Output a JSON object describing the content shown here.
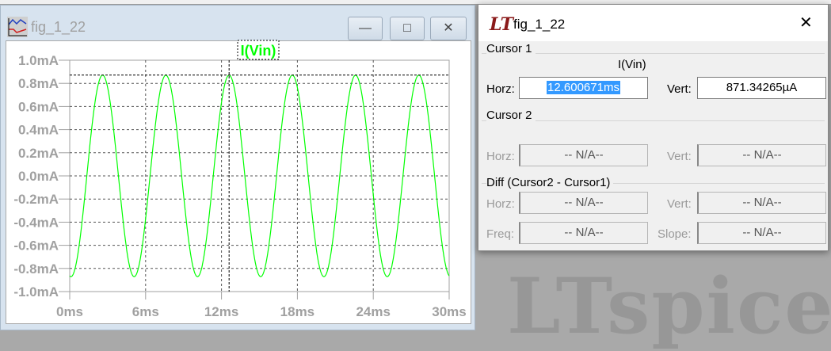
{
  "plot_window": {
    "title": "fig_1_22",
    "buttons": {
      "minimize": "—",
      "maximize": "□",
      "close": "✕"
    },
    "trace_label": "I(Vin)"
  },
  "chart_data": {
    "type": "line",
    "title": "I(Vin)",
    "xlabel": "",
    "ylabel": "",
    "xlim": [
      0,
      30
    ],
    "ylim": [
      -1.0,
      1.0
    ],
    "x_unit": "ms",
    "y_unit": "mA",
    "xticks": [
      "0ms",
      "6ms",
      "12ms",
      "18ms",
      "24ms",
      "30ms"
    ],
    "yticks": [
      "1.0mA",
      "0.8mA",
      "0.6mA",
      "0.4mA",
      "0.2mA",
      "0.0mA",
      "-0.2mA",
      "-0.4mA",
      "-0.6mA",
      "-0.8mA",
      "-1.0mA"
    ],
    "grid": true,
    "series": [
      {
        "name": "I(Vin)",
        "color": "#00ff00",
        "model": "sinusoid",
        "amplitude_mA": 0.871,
        "frequency_hz": 200,
        "first_minimum_ms": 0.1
      }
    ],
    "cursor": {
      "x_ms": 12.600671,
      "y_mA": 0.87134265
    }
  },
  "dialog": {
    "title": "fig_1_22",
    "close": "✕",
    "cursor1": {
      "label": "Cursor 1",
      "trace": "I(Vin)",
      "horz_label": "Horz:",
      "horz_value": "12.600671ms",
      "vert_label": "Vert:",
      "vert_value": "871.34265µA"
    },
    "cursor2": {
      "label": "Cursor 2",
      "horz_label": "Horz:",
      "horz_value": "-- N/A--",
      "vert_label": "Vert:",
      "vert_value": "-- N/A--"
    },
    "diff": {
      "label": "Diff (Cursor2 - Cursor1)",
      "horz_label": "Horz:",
      "horz_value": "-- N/A--",
      "vert_label": "Vert:",
      "vert_value": "-- N/A--",
      "freq_label": "Freq:",
      "freq_value": "-- N/A--",
      "slope_label": "Slope:",
      "slope_value": "-- N/A--"
    }
  },
  "background": {
    "watermark": "LTspice"
  }
}
